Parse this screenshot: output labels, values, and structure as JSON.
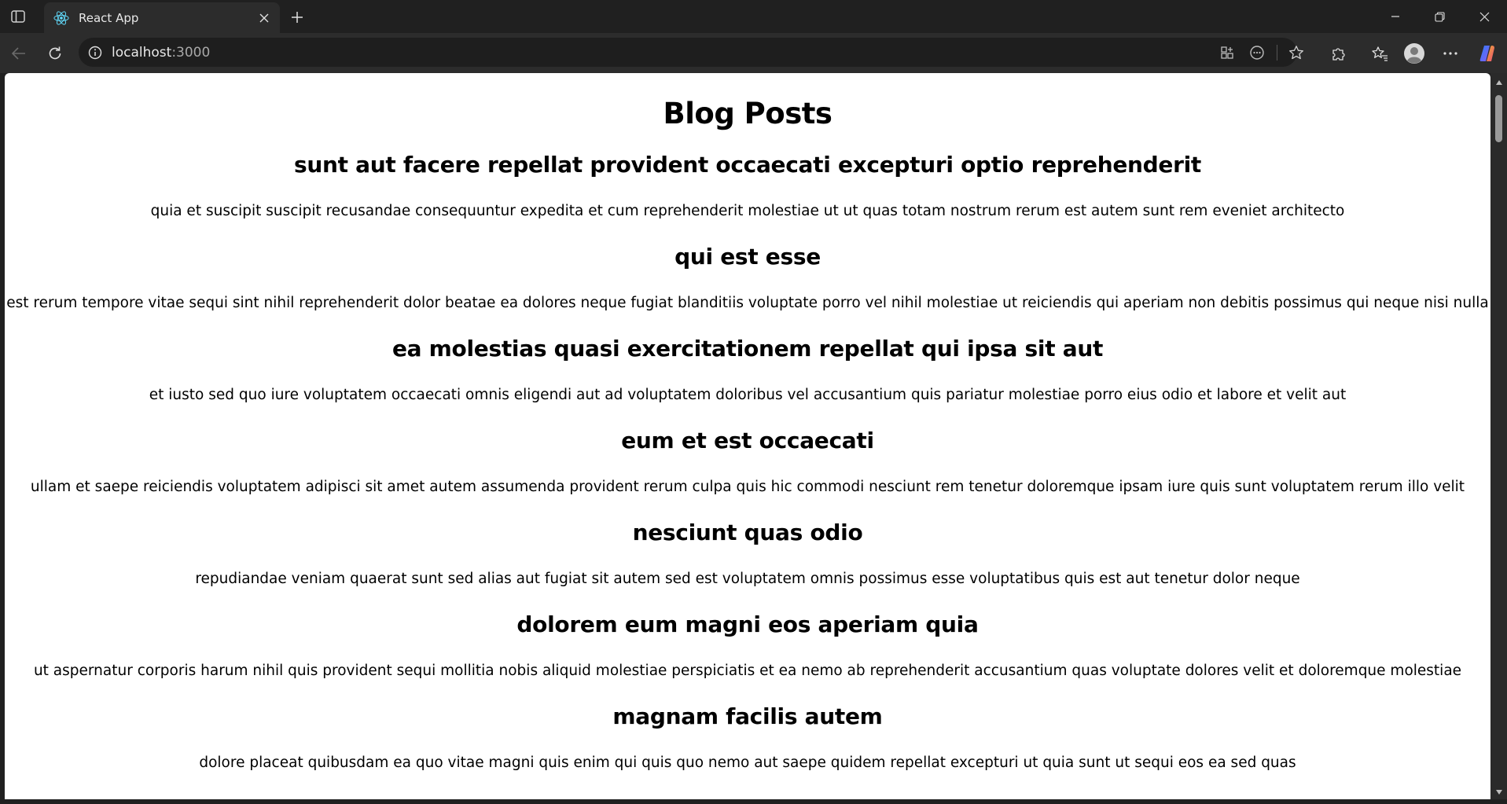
{
  "browser": {
    "tab_title": "React App",
    "url_host": "localhost",
    "url_port": ":3000"
  },
  "page": {
    "title": "Blog Posts",
    "posts": [
      {
        "title": "sunt aut facere repellat provident occaecati excepturi optio reprehenderit",
        "body": "quia et suscipit suscipit recusandae consequuntur expedita et cum reprehenderit molestiae ut ut quas totam nostrum rerum est autem sunt rem eveniet architecto"
      },
      {
        "title": "qui est esse",
        "body": "est rerum tempore vitae sequi sint nihil reprehenderit dolor beatae ea dolores neque fugiat blanditiis voluptate porro vel nihil molestiae ut reiciendis qui aperiam non debitis possimus qui neque nisi nulla"
      },
      {
        "title": "ea molestias quasi exercitationem repellat qui ipsa sit aut",
        "body": "et iusto sed quo iure voluptatem occaecati omnis eligendi aut ad voluptatem doloribus vel accusantium quis pariatur molestiae porro eius odio et labore et velit aut"
      },
      {
        "title": "eum et est occaecati",
        "body": "ullam et saepe reiciendis voluptatem adipisci sit amet autem assumenda provident rerum culpa quis hic commodi nesciunt rem tenetur doloremque ipsam iure quis sunt voluptatem rerum illo velit"
      },
      {
        "title": "nesciunt quas odio",
        "body": "repudiandae veniam quaerat sunt sed alias aut fugiat sit autem sed est voluptatem omnis possimus esse voluptatibus quis est aut tenetur dolor neque"
      },
      {
        "title": "dolorem eum magni eos aperiam quia",
        "body": "ut aspernatur corporis harum nihil quis provident sequi mollitia nobis aliquid molestiae perspiciatis et ea nemo ab reprehenderit accusantium quas voluptate dolores velit et doloremque molestiae"
      },
      {
        "title": "magnam facilis autem",
        "body": "dolore placeat quibusdam ea quo vitae magni quis enim qui quis quo nemo aut saepe quidem repellat excepturi ut quia sunt ut sequi eos ea sed quas"
      }
    ]
  },
  "icons": {
    "sidebar": "sidebar-toggle-icon",
    "favicon": "react-logo-icon",
    "close": "close-icon",
    "new_tab": "plus-icon",
    "minimize": "minimize-icon",
    "restore": "restore-icon",
    "window_close": "window-close-icon",
    "back": "back-arrow-icon",
    "reload": "reload-icon",
    "site_info": "info-icon",
    "app_available": "app-available-icon",
    "read_aloud": "browser-essentials-icon",
    "favorite": "star-icon",
    "extensions": "puzzle-icon",
    "favorites": "favorites-icon",
    "profile": "profile-icon",
    "menu": "more-icon",
    "copilot": "copilot-icon"
  },
  "colors": {
    "chrome_bg": "#202020",
    "toolbar_bg": "#2c2c2c",
    "page_bg": "#ffffff",
    "text": "#000000",
    "react_blue": "#61dafb"
  }
}
